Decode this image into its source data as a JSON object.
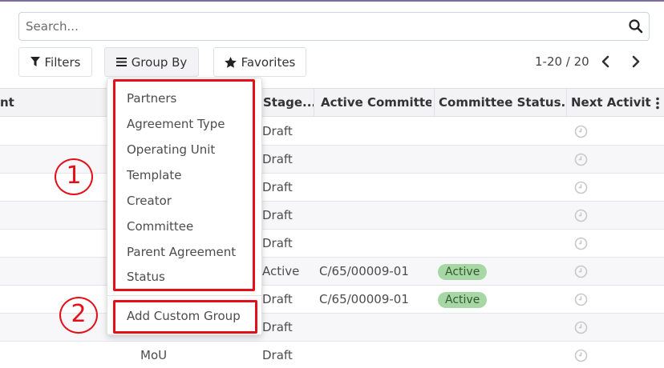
{
  "search": {
    "placeholder": "Search..."
  },
  "toolbar": {
    "filters_label": "Filters",
    "groupby_label": "Group By",
    "favorites_label": "Favorites"
  },
  "pager": {
    "range": "1-20 / 20"
  },
  "table": {
    "columns": [
      "nt",
      "Stage...",
      "Active Committee",
      "Committee Status...",
      "Next Activity"
    ],
    "rows": [
      {
        "first": "",
        "stage": "Draft",
        "committee": "",
        "status": ""
      },
      {
        "first": "",
        "stage": "Draft",
        "committee": "",
        "status": ""
      },
      {
        "first": "",
        "stage": "Draft",
        "committee": "",
        "status": ""
      },
      {
        "first": "",
        "stage": "Draft",
        "committee": "",
        "status": ""
      },
      {
        "first": "",
        "stage": "Draft",
        "committee": "",
        "status": ""
      },
      {
        "first": "",
        "stage": "Active",
        "committee": "C/65/00009-01",
        "status": "Active"
      },
      {
        "first": "",
        "stage": "Draft",
        "committee": "C/65/00009-01",
        "status": "Active"
      },
      {
        "first": "",
        "stage": "Draft",
        "committee": "",
        "status": ""
      },
      {
        "first": "MoU",
        "stage": "Draft",
        "committee": "",
        "status": ""
      }
    ]
  },
  "groupby_menu": {
    "items": [
      "Partners",
      "Agreement Type",
      "Operating Unit",
      "Template",
      "Creator",
      "Committee",
      "Parent Agreement",
      "Status"
    ],
    "custom_label": "Add Custom Group"
  },
  "annotations": {
    "marker1": "1",
    "marker2": "2",
    "color": "#e3101a"
  },
  "colors": {
    "badge_bg": "#a7d7a4",
    "header_bg": "#f3f3f5",
    "accent_top": "#7c6d9a"
  },
  "icons": [
    "search-icon",
    "filter-icon",
    "bars-icon",
    "star-icon",
    "chevron-left-icon",
    "chevron-right-icon",
    "clock-icon",
    "kebab-icon"
  ]
}
